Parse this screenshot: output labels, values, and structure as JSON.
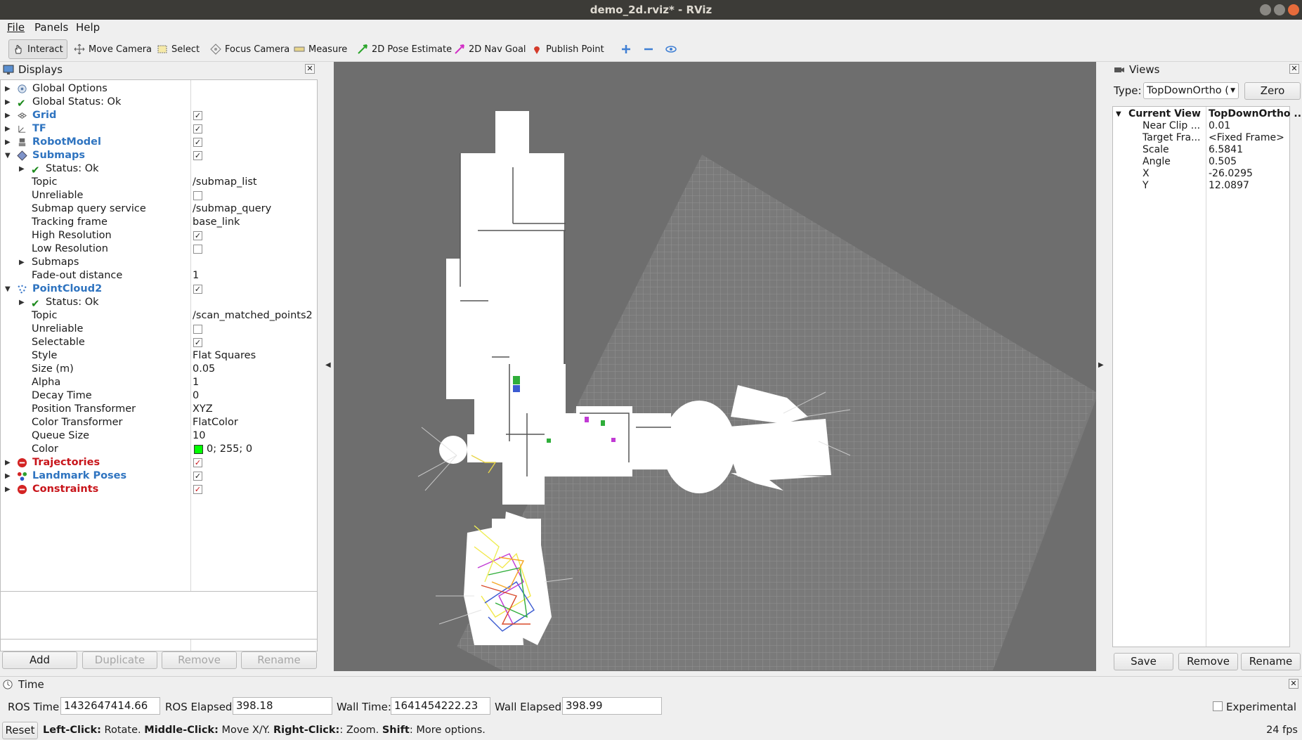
{
  "window": {
    "title": "demo_2d.rviz* - RViz"
  },
  "menu": [
    "File",
    "Panels",
    "Help"
  ],
  "toolbar": {
    "interact": "Interact",
    "move_camera": "Move Camera",
    "select": "Select",
    "focus_camera": "Focus Camera",
    "measure": "Measure",
    "pose_estimate": "2D Pose Estimate",
    "nav_goal": "2D Nav Goal",
    "publish_point": "Publish Point"
  },
  "displays": {
    "title": "Displays",
    "rows": [
      {
        "label": "Global Options",
        "value": ""
      },
      {
        "label": "Global Status: Ok",
        "value": ""
      },
      {
        "label": "Grid",
        "value": ""
      },
      {
        "label": "TF",
        "value": ""
      },
      {
        "label": "RobotModel",
        "value": ""
      },
      {
        "label": "Submaps",
        "value": ""
      },
      {
        "label": "Status: Ok",
        "value": ""
      },
      {
        "label": "Topic",
        "value": "/submap_list"
      },
      {
        "label": "Unreliable",
        "value": ""
      },
      {
        "label": "Submap query service",
        "value": "/submap_query"
      },
      {
        "label": "Tracking frame",
        "value": "base_link"
      },
      {
        "label": "High Resolution",
        "value": ""
      },
      {
        "label": "Low Resolution",
        "value": ""
      },
      {
        "label": "Submaps",
        "value": ""
      },
      {
        "label": "Fade-out distance",
        "value": "1"
      },
      {
        "label": "PointCloud2",
        "value": ""
      },
      {
        "label": "Status: Ok",
        "value": ""
      },
      {
        "label": "Topic",
        "value": "/scan_matched_points2"
      },
      {
        "label": "Unreliable",
        "value": ""
      },
      {
        "label": "Selectable",
        "value": ""
      },
      {
        "label": "Style",
        "value": "Flat Squares"
      },
      {
        "label": "Size (m)",
        "value": "0.05"
      },
      {
        "label": "Alpha",
        "value": "1"
      },
      {
        "label": "Decay Time",
        "value": "0"
      },
      {
        "label": "Position Transformer",
        "value": "XYZ"
      },
      {
        "label": "Color Transformer",
        "value": "FlatColor"
      },
      {
        "label": "Queue Size",
        "value": "10"
      },
      {
        "label": "Color",
        "value": "0; 255; 0"
      },
      {
        "label": "Trajectories",
        "value": ""
      },
      {
        "label": "Landmark Poses",
        "value": ""
      },
      {
        "label": "Constraints",
        "value": ""
      }
    ],
    "buttons": {
      "add": "Add",
      "duplicate": "Duplicate",
      "remove": "Remove",
      "rename": "Rename"
    }
  },
  "views": {
    "title": "Views",
    "type_label": "Type:",
    "type_value": "TopDownOrtho (",
    "zero": "Zero",
    "current_view": "Current View",
    "current_view_value": "TopDownOrtho ...",
    "props": [
      {
        "k": "Near Clip ...",
        "v": "0.01"
      },
      {
        "k": "Target Fra...",
        "v": "<Fixed Frame>"
      },
      {
        "k": "Scale",
        "v": "6.5841"
      },
      {
        "k": "Angle",
        "v": "0.505"
      },
      {
        "k": "X",
        "v": "-26.0295"
      },
      {
        "k": "Y",
        "v": "12.0897"
      }
    ],
    "buttons": {
      "save": "Save",
      "remove": "Remove",
      "rename": "Rename"
    }
  },
  "time": {
    "title": "Time",
    "ros_time_label": "ROS Time:",
    "ros_time": "1432647414.66",
    "ros_elapsed_label": "ROS Elapsed:",
    "ros_elapsed": "398.18",
    "wall_time_label": "Wall Time:",
    "wall_time": "1641454222.23",
    "wall_elapsed_label": "Wall Elapsed:",
    "wall_elapsed": "398.99",
    "experimental": "Experimental"
  },
  "status": {
    "reset": "Reset",
    "lc_b": "Left-Click:",
    "lc": " Rotate. ",
    "mc_b": "Middle-Click:",
    "mc": " Move X/Y. ",
    "rc_b": "Right-Click:",
    "rc": ": Zoom. ",
    "sh_b": "Shift",
    "sh": ": More options.",
    "fps": "24 fps"
  },
  "colors": {
    "submap_blue": "#2f74c0",
    "error_red": "#c8151b",
    "pointcloud_green": "#00ff00",
    "viewport_bg": "#6e6e6e"
  }
}
